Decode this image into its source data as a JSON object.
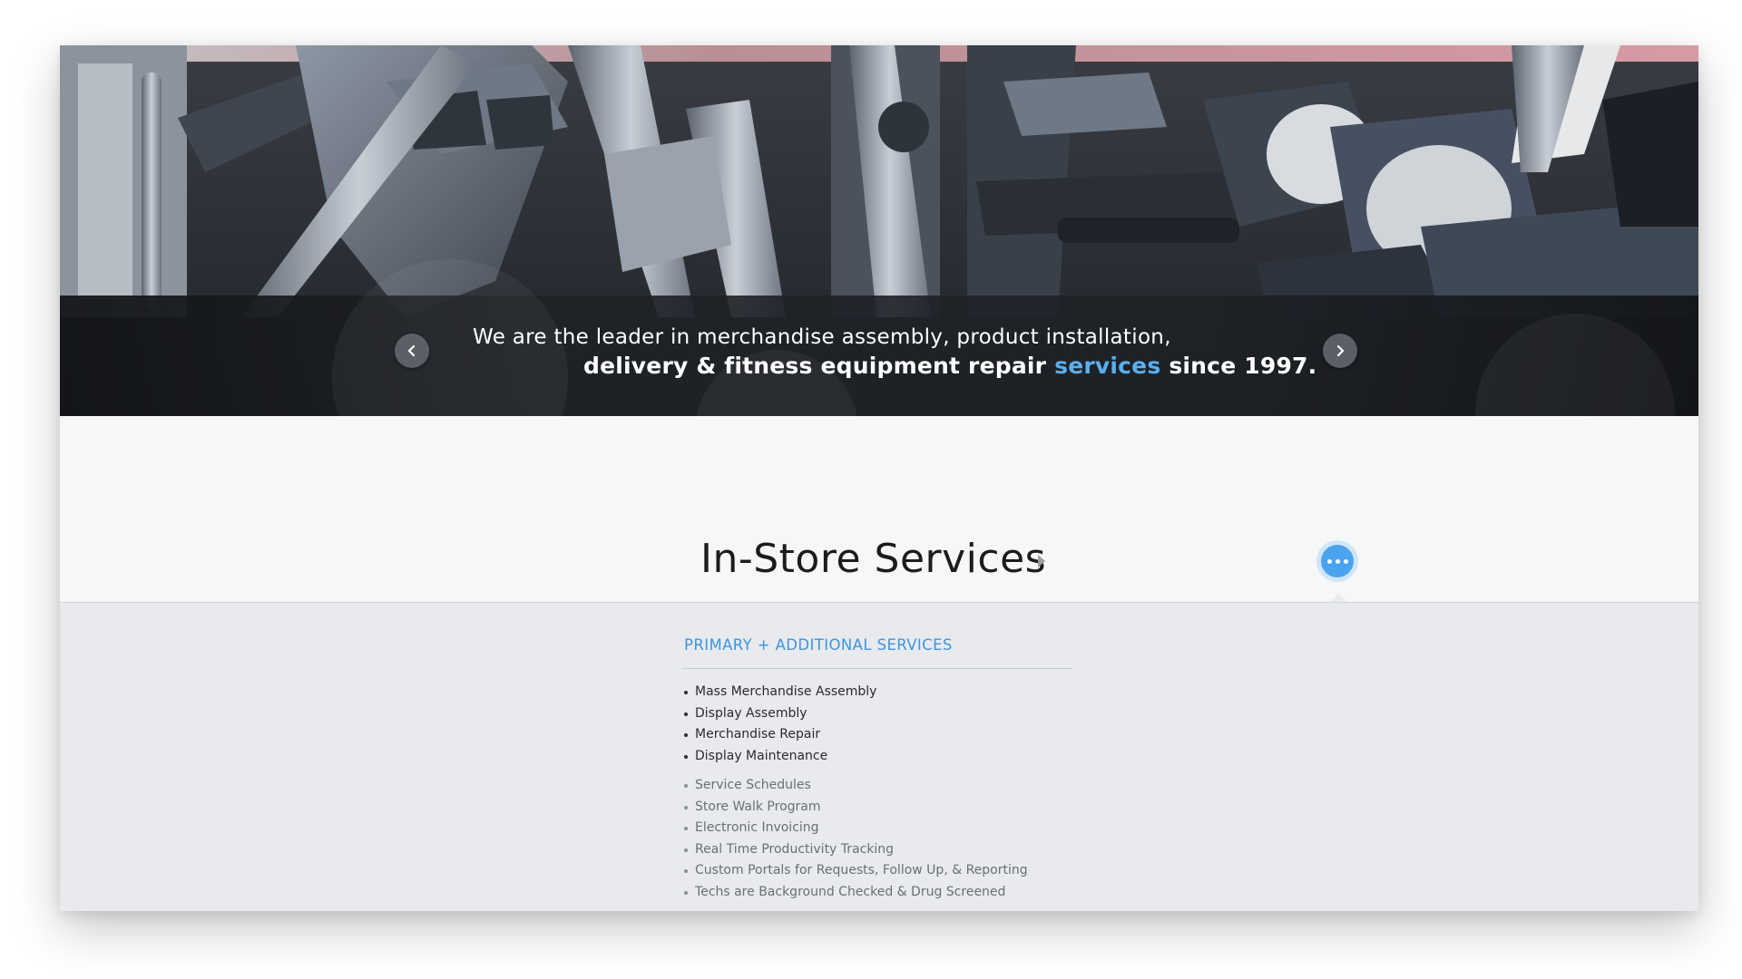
{
  "hero": {
    "caption_line1": "We are the leader in merchandise assembly, product installation,",
    "caption_line2_prefix": "delivery & fitness equipment repair ",
    "caption_line2_highlight": "services",
    "caption_line2_suffix": " since 1997.",
    "prev_icon": "chevron-left-icon",
    "next_icon": "chevron-right-icon"
  },
  "section": {
    "title": "In-Store Services",
    "title_icon": "caret-right-icon",
    "more_icon": "ellipsis-icon"
  },
  "services": {
    "heading": "PRIMARY + ADDITIONAL SERVICES",
    "primary": [
      "Mass Merchandise Assembly",
      "Display Assembly",
      "Merchandise Repair",
      "Display Maintenance"
    ],
    "additional": [
      "Service Schedules",
      "Store Walk Program",
      "Electronic Invoicing",
      "Real Time Productivity Tracking",
      "Custom Portals for Requests, Follow Up, & Reporting",
      "Techs are Background Checked & Drug Screened"
    ]
  },
  "colors": {
    "accent": "#4aa3ef",
    "heading_blue": "#3d95e2",
    "caption_highlight": "#5aaff0",
    "panel_bg": "#e8eaed",
    "title_band_bg": "#f7f7f7"
  }
}
